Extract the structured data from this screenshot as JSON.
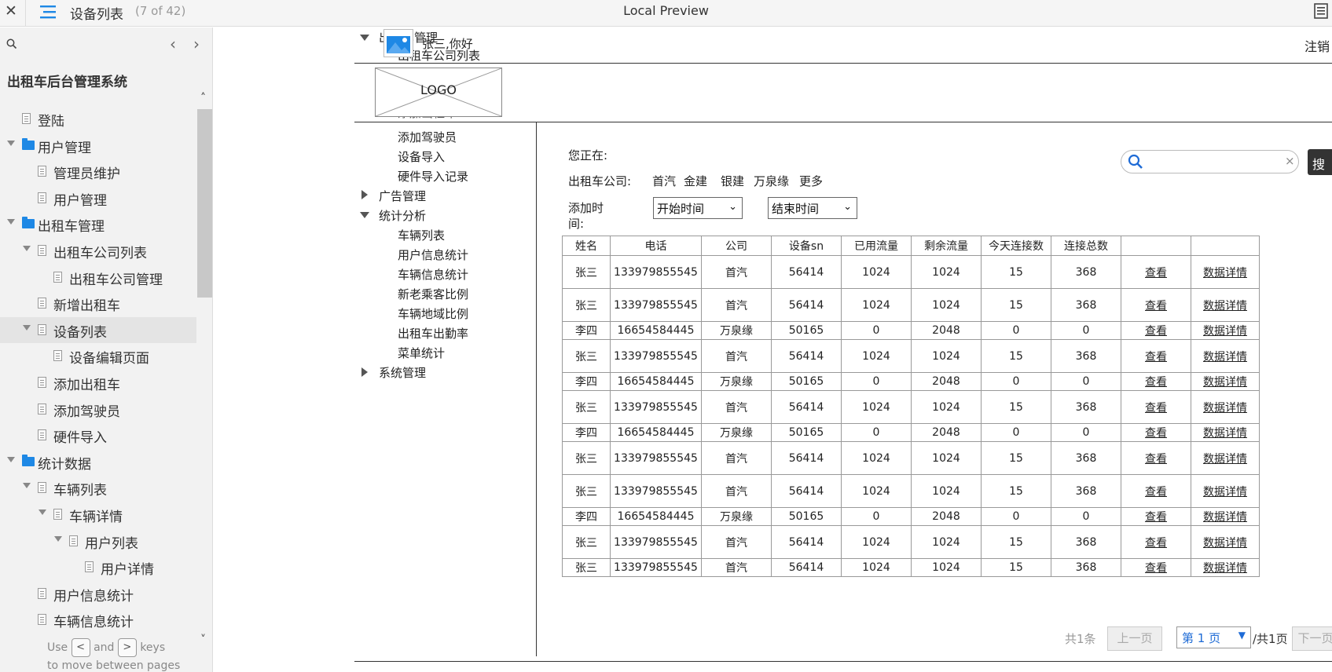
{
  "topbar": {
    "title": "设备列表",
    "page_count": "(7 of 42)",
    "app_title": "Local Preview"
  },
  "sidebar": {
    "system_title": "出租车后台管理系统",
    "items": [
      {
        "label": "登陆",
        "type": "page",
        "depth": 0,
        "expanded": false
      },
      {
        "label": "用户管理",
        "type": "folder",
        "depth": 0,
        "expanded": true
      },
      {
        "label": "管理员维护",
        "type": "page",
        "depth": 1,
        "expanded": false
      },
      {
        "label": "用户管理",
        "type": "page",
        "depth": 1,
        "expanded": false
      },
      {
        "label": "出租车管理",
        "type": "folder",
        "depth": 0,
        "expanded": true
      },
      {
        "label": "出租车公司列表",
        "type": "page",
        "depth": 1,
        "expanded": true
      },
      {
        "label": "出租车公司管理",
        "type": "page",
        "depth": 2,
        "expanded": false
      },
      {
        "label": "新增出租车",
        "type": "page",
        "depth": 1,
        "expanded": false
      },
      {
        "label": "设备列表",
        "type": "page",
        "depth": 1,
        "expanded": true,
        "selected": true
      },
      {
        "label": "设备编辑页面",
        "type": "page",
        "depth": 2,
        "expanded": false
      },
      {
        "label": "添加出租车",
        "type": "page",
        "depth": 1,
        "expanded": false
      },
      {
        "label": "添加驾驶员",
        "type": "page",
        "depth": 1,
        "expanded": false
      },
      {
        "label": "硬件导入",
        "type": "page",
        "depth": 1,
        "expanded": false
      },
      {
        "label": "统计数据",
        "type": "folder",
        "depth": 0,
        "expanded": true
      },
      {
        "label": "车辆列表",
        "type": "page",
        "depth": 1,
        "expanded": true
      },
      {
        "label": "车辆详情",
        "type": "page",
        "depth": 2,
        "expanded": true
      },
      {
        "label": "用户列表",
        "type": "page",
        "depth": 3,
        "expanded": true
      },
      {
        "label": "用户详情",
        "type": "page",
        "depth": 4,
        "expanded": false
      },
      {
        "label": "用户信息统计",
        "type": "page",
        "depth": 1,
        "expanded": false
      },
      {
        "label": "车辆信息统计",
        "type": "page",
        "depth": 1,
        "expanded": false
      }
    ],
    "hint": {
      "use": "Use",
      "and": "and",
      "keys": "keys",
      "line2": "to move between pages",
      "prev_key": "<",
      "next_key": ">"
    }
  },
  "proto": {
    "greeting": "张三,你好",
    "logout": "注销",
    "logo": "LOGO",
    "nav_overlap": {
      "taxi_mgmt": "出租车管理",
      "taxi_company_list": "出租车公司列表",
      "add_taxi_clipped": "添加出租车"
    },
    "nav": {
      "add_driver": "添加驾驶员",
      "device_import": "设备导入",
      "hw_import_records": "硬件导入记录",
      "ad_mgmt": "广告管理",
      "stats": "统计分析",
      "stats_items": [
        "车辆列表",
        "用户信息统计",
        "车辆信息统计",
        "新老乘客比例",
        "车辆地域比例",
        "出租车出勤率",
        "菜单统计"
      ],
      "sys_mgmt": "系统管理"
    },
    "location_label": "您正在:",
    "company_label": "出租车公司:",
    "companies": [
      "首汽",
      "金建",
      "银建",
      "万泉缘",
      "更多"
    ],
    "add_time_label_1": "添加时",
    "add_time_label_2": "间:",
    "start_time": "开始时间",
    "end_time": "结束时间",
    "search_button": "搜索",
    "search_clear": "×",
    "table": {
      "headers": [
        "姓名",
        "电话",
        "公司",
        "设备sn",
        "已用流量",
        "剩余流量",
        "今天连接数",
        "连接总数",
        "",
        ""
      ],
      "rows": [
        [
          "张三",
          "133979855545",
          "首汽",
          "56414",
          "1024",
          "1024",
          "15",
          "368",
          "查看",
          "数据详情"
        ],
        [
          "张三",
          "133979855545",
          "首汽",
          "56414",
          "1024",
          "1024",
          "15",
          "368",
          "查看",
          "数据详情"
        ],
        [
          "李四",
          "16654584445",
          "万泉缘",
          "50165",
          "0",
          "2048",
          "0",
          "0",
          "查看",
          "数据详情"
        ],
        [
          "张三",
          "133979855545",
          "首汽",
          "56414",
          "1024",
          "1024",
          "15",
          "368",
          "查看",
          "数据详情"
        ],
        [
          "李四",
          "16654584445",
          "万泉缘",
          "50165",
          "0",
          "2048",
          "0",
          "0",
          "查看",
          "数据详情"
        ],
        [
          "张三",
          "133979855545",
          "首汽",
          "56414",
          "1024",
          "1024",
          "15",
          "368",
          "查看",
          "数据详情"
        ],
        [
          "李四",
          "16654584445",
          "万泉缘",
          "50165",
          "0",
          "2048",
          "0",
          "0",
          "查看",
          "数据详情"
        ],
        [
          "张三",
          "133979855545",
          "首汽",
          "56414",
          "1024",
          "1024",
          "15",
          "368",
          "查看",
          "数据详情"
        ],
        [
          "张三",
          "133979855545",
          "首汽",
          "56414",
          "1024",
          "1024",
          "15",
          "368",
          "查看",
          "数据详情"
        ],
        [
          "李四",
          "16654584445",
          "万泉缘",
          "50165",
          "0",
          "2048",
          "0",
          "0",
          "查看",
          "数据详情"
        ],
        [
          "张三",
          "133979855545",
          "首汽",
          "56414",
          "1024",
          "1024",
          "15",
          "368",
          "查看",
          "数据详情"
        ],
        [
          "张三",
          "133979855545",
          "首汽",
          "56414",
          "1024",
          "1024",
          "15",
          "368",
          "查看",
          "数据详情"
        ]
      ]
    },
    "pager": {
      "total": "共1条",
      "prev": "上一页",
      "page_select": "第  1  页",
      "total_pages": "/共1页",
      "next": "下一页"
    }
  }
}
